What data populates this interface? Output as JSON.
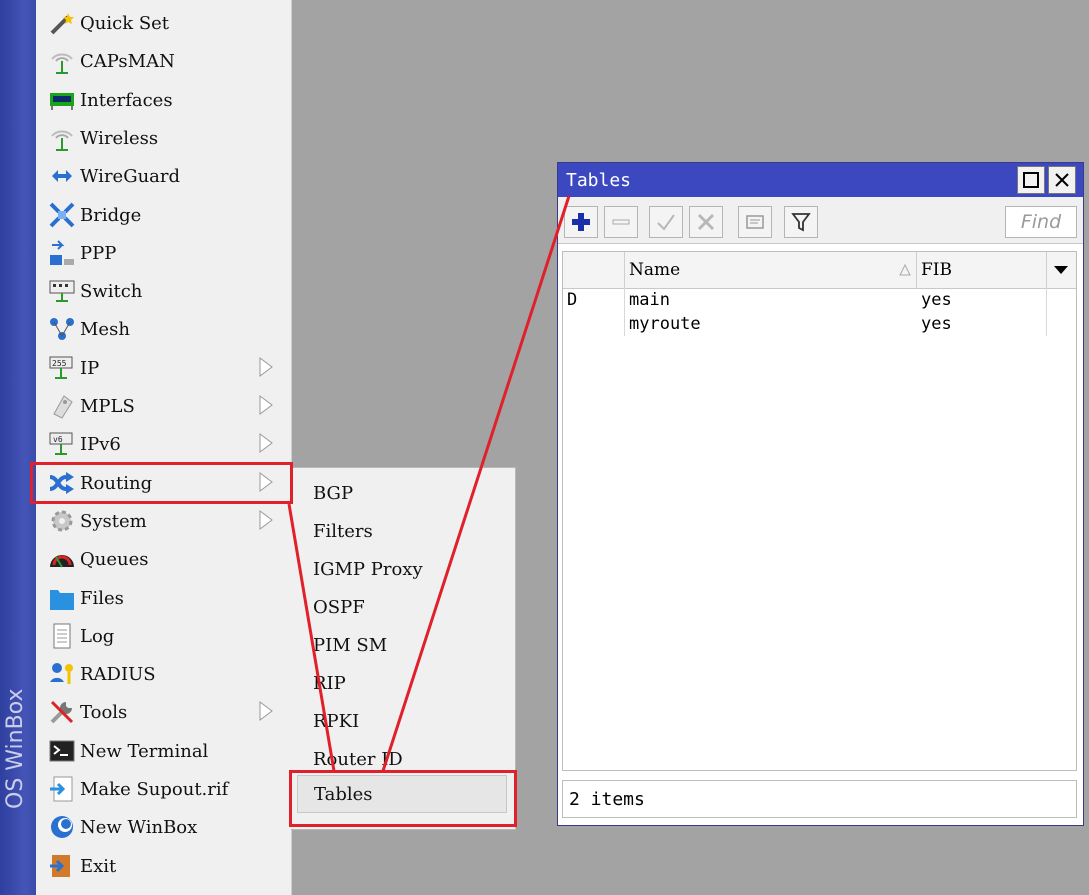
{
  "sidebar": {
    "vertical_text": "OS WinBox"
  },
  "menu": {
    "items": [
      {
        "label": "Quick Set",
        "icon": "wand-icon"
      },
      {
        "label": "CAPsMAN",
        "icon": "antenna-icon"
      },
      {
        "label": "Interfaces",
        "icon": "network-card-icon"
      },
      {
        "label": "Wireless",
        "icon": "antenna-icon"
      },
      {
        "label": "WireGuard",
        "icon": "double-arrow-icon"
      },
      {
        "label": "Bridge",
        "icon": "bridge-icon"
      },
      {
        "label": "PPP",
        "icon": "ppp-icon"
      },
      {
        "label": "Switch",
        "icon": "switch-icon"
      },
      {
        "label": "Mesh",
        "icon": "mesh-icon"
      },
      {
        "label": "IP",
        "icon": "ip-icon",
        "submenu": true
      },
      {
        "label": "MPLS",
        "icon": "mpls-icon",
        "submenu": true
      },
      {
        "label": "IPv6",
        "icon": "ipv6-icon",
        "submenu": true
      },
      {
        "label": "Routing",
        "icon": "routing-icon",
        "submenu": true
      },
      {
        "label": "System",
        "icon": "gear-icon",
        "submenu": true
      },
      {
        "label": "Queues",
        "icon": "queues-icon"
      },
      {
        "label": "Files",
        "icon": "folder-icon"
      },
      {
        "label": "Log",
        "icon": "log-icon"
      },
      {
        "label": "RADIUS",
        "icon": "radius-icon"
      },
      {
        "label": "Tools",
        "icon": "tools-icon",
        "submenu": true
      },
      {
        "label": "New Terminal",
        "icon": "terminal-icon"
      },
      {
        "label": "Make Supout.rif",
        "icon": "supout-icon"
      },
      {
        "label": "New WinBox",
        "icon": "winbox-icon"
      },
      {
        "label": "Exit",
        "icon": "exit-icon"
      }
    ]
  },
  "routing_submenu": {
    "items": [
      "BGP",
      "Filters",
      "IGMP Proxy",
      "OSPF",
      "PIM SM",
      "RIP",
      "RPKI",
      "Router ID",
      "Tables"
    ],
    "selected": "Tables"
  },
  "window": {
    "title": "Tables",
    "find_placeholder": "Find",
    "columns": [
      "Name",
      "FIB"
    ],
    "rows": [
      {
        "flag": "D",
        "name": "main",
        "fib": "yes"
      },
      {
        "flag": "",
        "name": "myroute",
        "fib": "yes"
      }
    ],
    "status": "2 items"
  },
  "colors": {
    "titlebar": "#3c48c0",
    "highlight": "#e0202a",
    "add_icon": "#1a2fa8"
  }
}
